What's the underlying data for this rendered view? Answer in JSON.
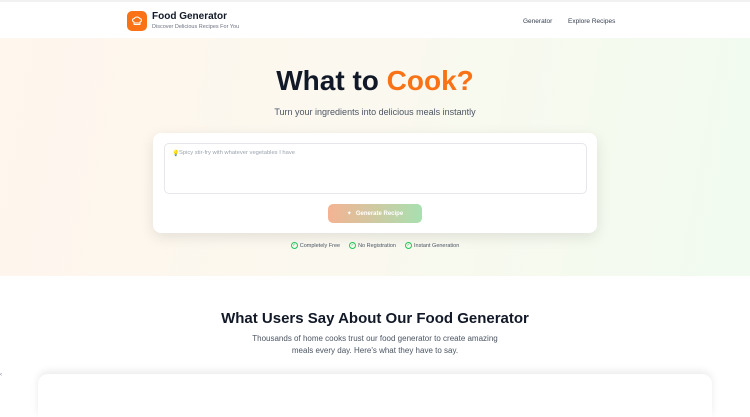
{
  "header": {
    "brand_title": "Food Generator",
    "brand_subtitle": "Discover Delicious Recipes For You",
    "nav": [
      {
        "label": "Generator"
      },
      {
        "label": "Explore Recipes"
      }
    ]
  },
  "hero": {
    "title_part1": "What to ",
    "title_accent": "Cook?",
    "subtitle": "Turn your ingredients into delicious meals instantly",
    "input_placeholder": "Spicy stir-fry with whatever vegetables I have",
    "generate_label": "Generate Recipe",
    "features": [
      {
        "label": "Completely Free"
      },
      {
        "label": "No Registration"
      },
      {
        "label": "Instant Generation"
      }
    ]
  },
  "testimonials": {
    "title": "What Users Say About Our Food Generator",
    "subtitle": "Thousands of home cooks trust our food generator to create amazing meals every day. Here's what they have to say."
  },
  "colors": {
    "accent": "#f97316",
    "success": "#22c55e"
  },
  "icons": {
    "logo": "chef-hat-icon",
    "input": "lightbulb-icon",
    "button": "sparkle-icon",
    "feature": "check-circle-icon"
  }
}
